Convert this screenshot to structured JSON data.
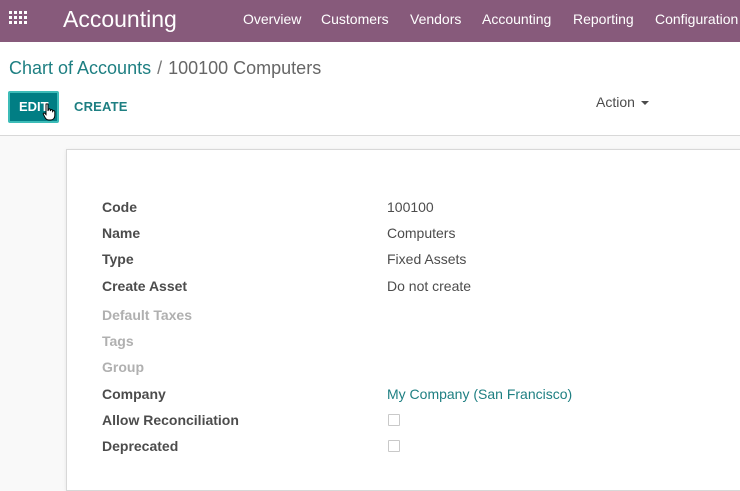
{
  "navbar": {
    "app_title": "Accounting",
    "menu": [
      "Overview",
      "Customers",
      "Vendors",
      "Accounting",
      "Reporting",
      "Configuration"
    ],
    "color": "#875a7b"
  },
  "breadcrumb": {
    "parent": "Chart of Accounts",
    "separator": "/",
    "current": "100100 Computers"
  },
  "toolbar": {
    "edit_label": "EDIT",
    "create_label": "CREATE",
    "action_label": "Action",
    "accent": "#017e84"
  },
  "form": {
    "fields": [
      {
        "label": "Code",
        "value": "100100"
      },
      {
        "label": "Name",
        "value": "Computers"
      },
      {
        "label": "Type",
        "value": "Fixed Assets"
      },
      {
        "label": "Create Asset",
        "value": "Do not create"
      },
      {
        "label": "Default Taxes",
        "value": ""
      },
      {
        "label": "Tags",
        "value": ""
      },
      {
        "label": "Group",
        "value": ""
      },
      {
        "label": "Company",
        "value": "My Company (San Francisco)"
      },
      {
        "label": "Allow Reconciliation",
        "checked": false
      },
      {
        "label": "Deprecated",
        "checked": false
      }
    ]
  }
}
